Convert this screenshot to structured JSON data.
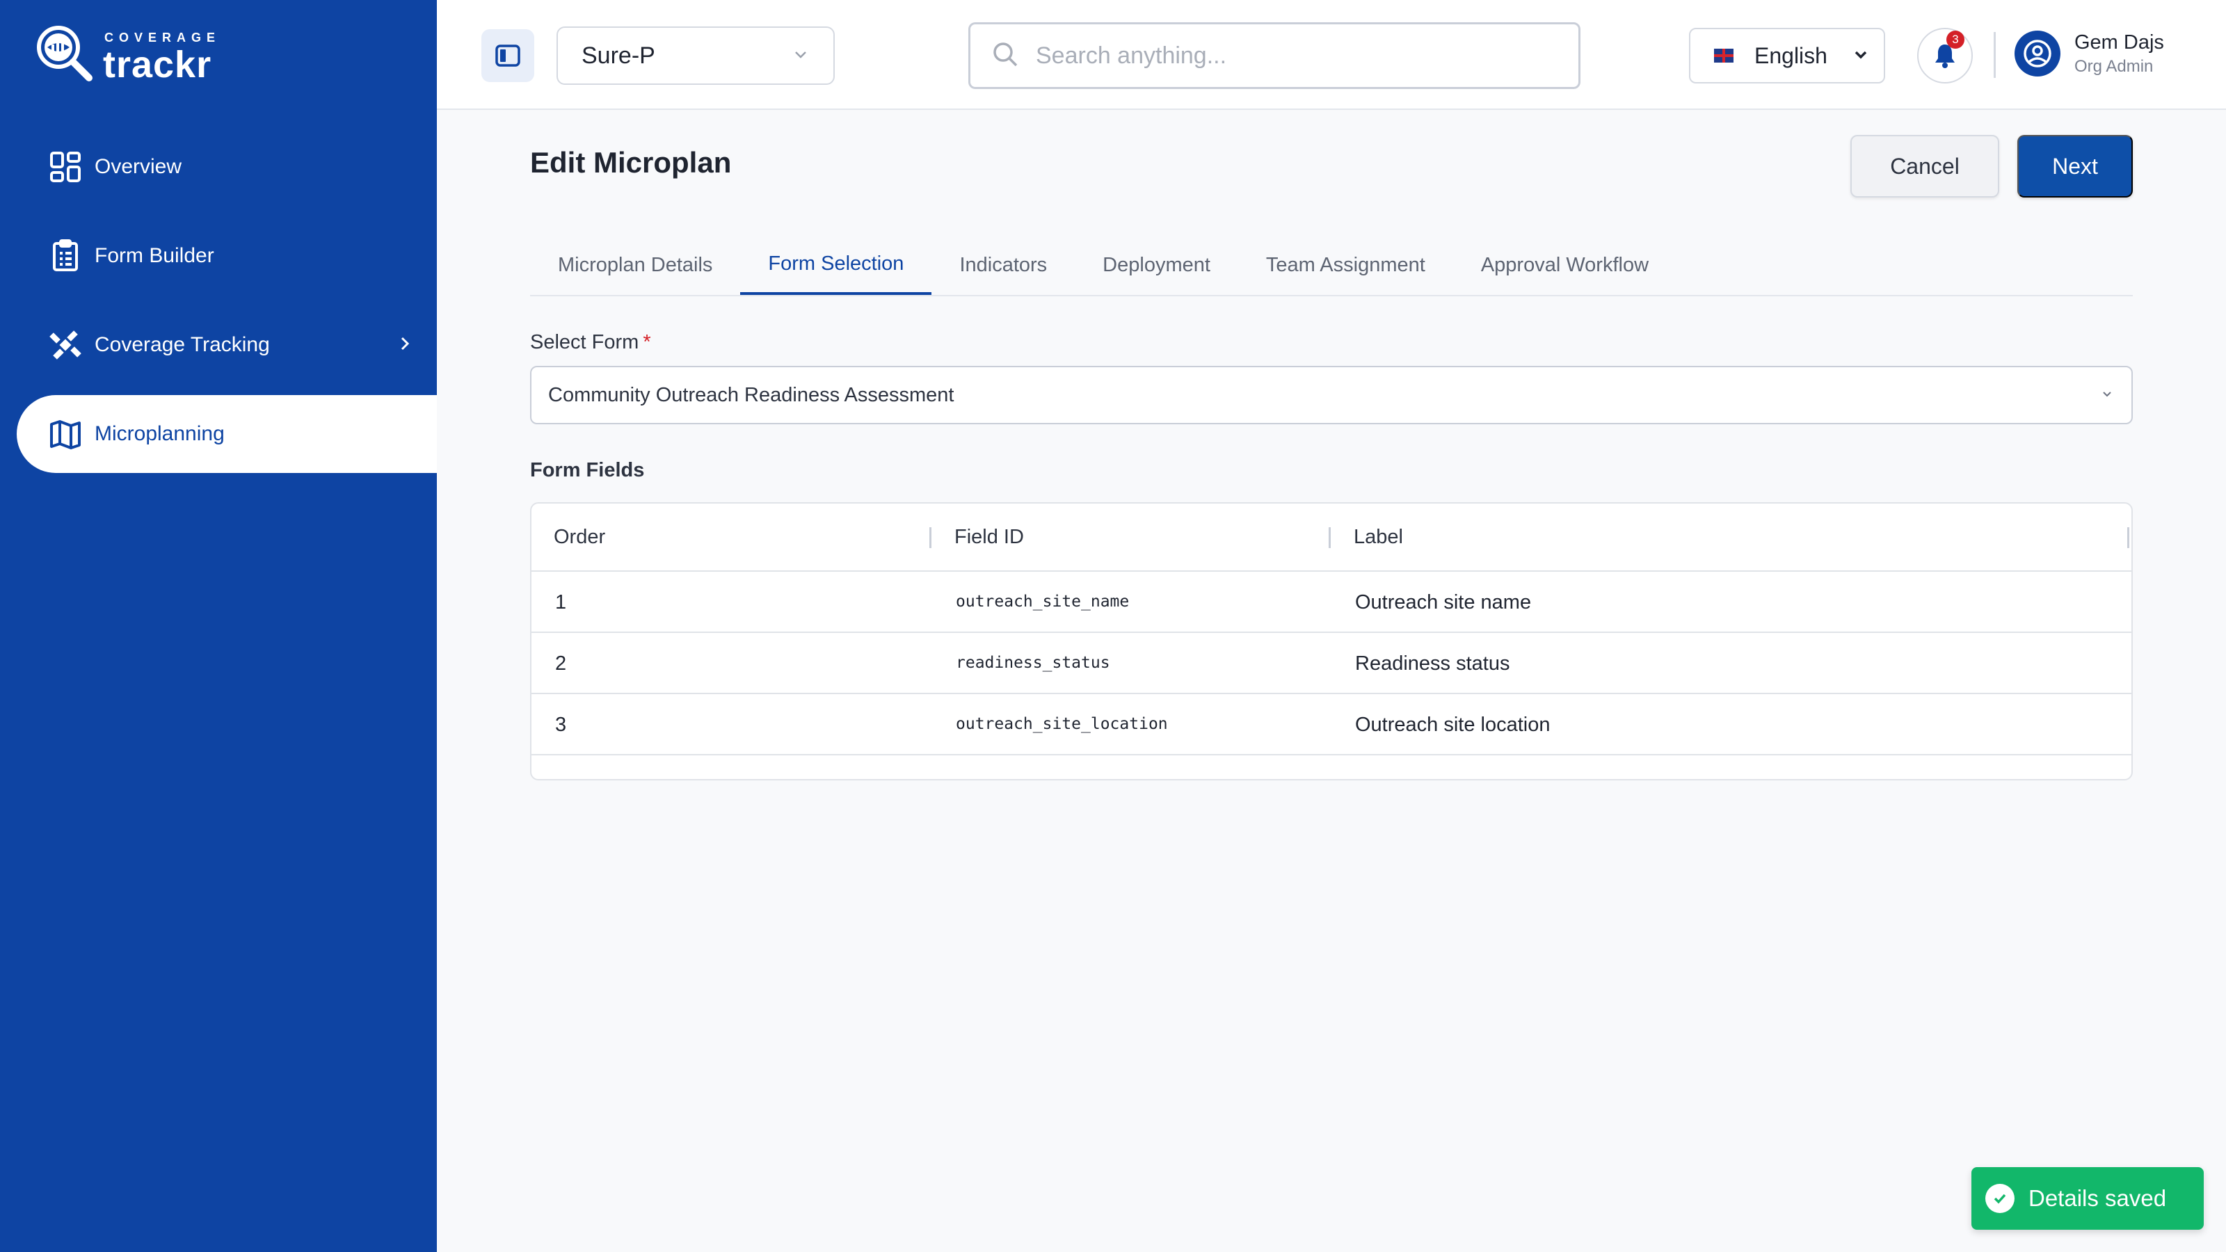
{
  "brand": {
    "small": "COVERAGE",
    "big": "trackr"
  },
  "sidebar": {
    "items": [
      {
        "label": "Overview",
        "icon": "grid-icon"
      },
      {
        "label": "Form Builder",
        "icon": "clipboard-icon"
      },
      {
        "label": "Coverage Tracking",
        "icon": "satellite-icon",
        "has_submenu": true
      },
      {
        "label": "Microplanning",
        "icon": "map-icon",
        "active": true
      }
    ]
  },
  "topbar": {
    "project": "Sure-P",
    "search_placeholder": "Search anything...",
    "language": "English",
    "notifications_count": "3",
    "user": {
      "name": "Gem Dajs",
      "role": "Org Admin"
    }
  },
  "page": {
    "title": "Edit Microplan",
    "cancel_label": "Cancel",
    "next_label": "Next",
    "tabs": [
      {
        "label": "Microplan Details"
      },
      {
        "label": "Form Selection",
        "active": true
      },
      {
        "label": "Indicators"
      },
      {
        "label": "Deployment"
      },
      {
        "label": "Team Assignment"
      },
      {
        "label": "Approval Workflow"
      }
    ],
    "select_form_label": "Select Form",
    "required_mark": "*",
    "selected_form": "Community Outreach Readiness Assessment",
    "form_fields_title": "Form Fields",
    "table": {
      "headers": [
        "Order",
        "Field ID",
        "Label"
      ],
      "rows": [
        {
          "order": "1",
          "field_id": "outreach_site_name",
          "label": "Outreach site name"
        },
        {
          "order": "2",
          "field_id": "readiness_status",
          "label": "Readiness status"
        },
        {
          "order": "3",
          "field_id": "outreach_site_location",
          "label": "Outreach site location"
        }
      ]
    }
  },
  "toast": {
    "message": "Details saved"
  },
  "colors": {
    "primary": "#0e44a3",
    "success": "#12b76a",
    "danger": "#d42027"
  }
}
